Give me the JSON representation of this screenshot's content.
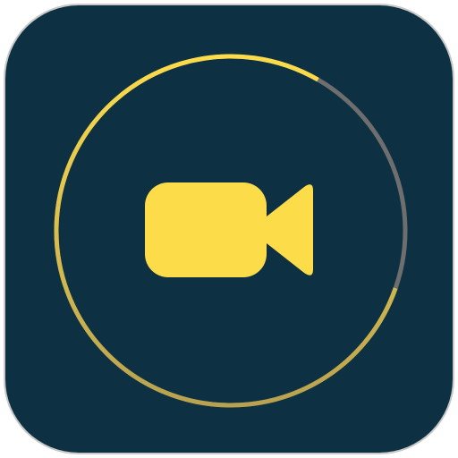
{
  "app_icon": {
    "name": "video-recorder-app",
    "icon": "video-camera-icon",
    "background_color": "#0d3142",
    "border_color": "#c8c8c8",
    "camera_color": "#fddc4a",
    "progress": {
      "fraction": 0.78,
      "fill_color_start": "#fddc4a",
      "fill_color_end": "#b9a24f",
      "track_color": "#6e6e6e"
    }
  }
}
